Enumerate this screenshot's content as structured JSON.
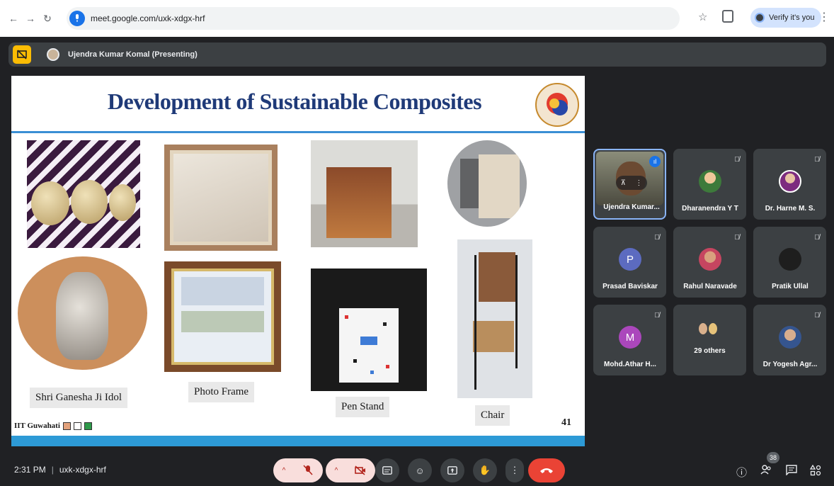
{
  "browser": {
    "url": "meet.google.com/uxk-xdgx-hrf",
    "verify_label": "Verify it's you"
  },
  "presenter": {
    "name": "Ujendra Kumar Komal (Presenting)"
  },
  "slide": {
    "title": "Development of Sustainable Composites",
    "captions": {
      "ganesha": "Shri Ganesha Ji Idol",
      "photo_frame": "Photo Frame",
      "pen_stand": "Pen Stand",
      "chair": "Chair"
    },
    "footer": "IIT Guwahati",
    "footer_squares": [
      "#e3a27c",
      "#ffffff",
      "#2e9a4a"
    ],
    "page_number": "41"
  },
  "participants": [
    {
      "name": "Ujendra Kumar...",
      "type": "video",
      "speaking": true
    },
    {
      "name": "Dharanendra Y T",
      "type": "photo1",
      "muted": true
    },
    {
      "name": "Dr. Harne M. S.",
      "type": "photo2",
      "muted": true
    },
    {
      "name": "Prasad Baviskar",
      "type": "initial",
      "initial": "P",
      "color": "#5c6bc0",
      "muted": true
    },
    {
      "name": "Rahul Naravade",
      "type": "photo3",
      "muted": true
    },
    {
      "name": "Pratik Ullal",
      "type": "dark",
      "muted": true
    },
    {
      "name": "Mohd.Athar H...",
      "type": "initial",
      "initial": "M",
      "color": "#ab47bc",
      "muted": true
    },
    {
      "name": "29 others",
      "type": "others"
    },
    {
      "name": "Dr Yogesh Agr...",
      "type": "photo4",
      "muted": true
    }
  ],
  "meeting": {
    "time": "2:31 PM",
    "code": "uxk-xdgx-hrf",
    "people_count": "38"
  },
  "colors": {
    "accent": "#1a73e8",
    "hangup": "#ea4335",
    "presenter_badge": "#fbbc04"
  }
}
